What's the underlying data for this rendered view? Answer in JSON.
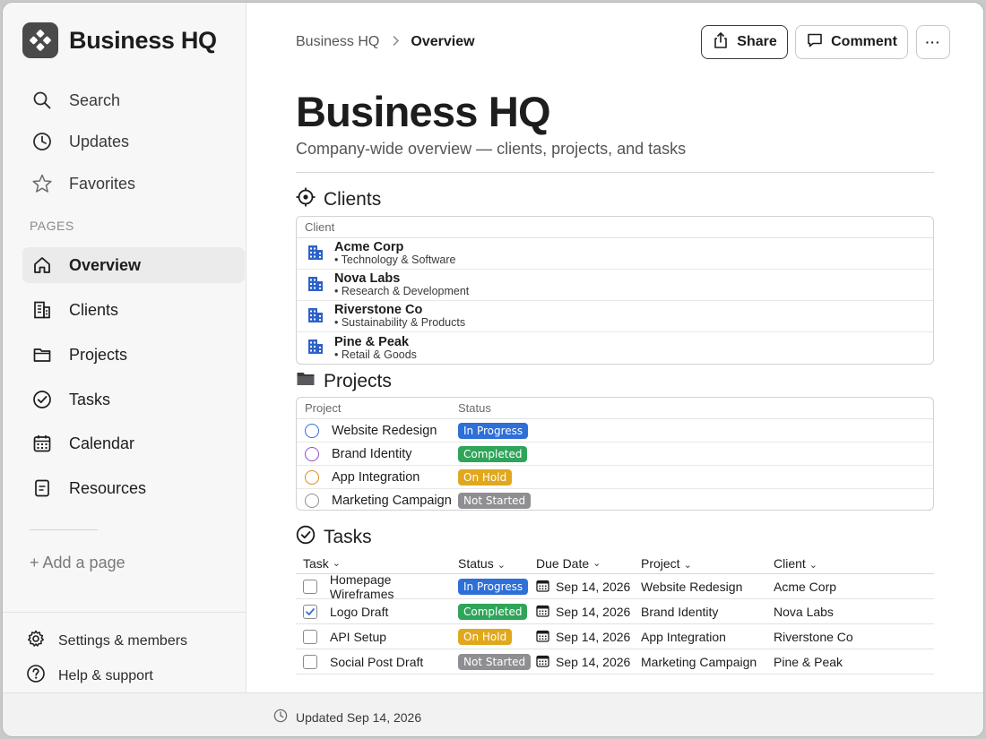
{
  "sidebar": {
    "brand": "Business HQ",
    "nav": [
      {
        "label": "Search",
        "icon": "search-icon"
      },
      {
        "label": "Updates",
        "icon": "clock-icon"
      },
      {
        "label": "Favorites",
        "icon": "star-icon"
      }
    ],
    "section_label": "PAGES",
    "pages": [
      {
        "label": "Overview",
        "icon": "home-icon",
        "active": true
      },
      {
        "label": "Clients",
        "icon": "building-icon"
      },
      {
        "label": "Projects",
        "icon": "folder-icon"
      },
      {
        "label": "Tasks",
        "icon": "check-circle-icon"
      },
      {
        "label": "Calendar",
        "icon": "calendar-icon"
      },
      {
        "label": "Resources",
        "icon": "document-icon"
      }
    ],
    "add_page": "+ Add a page",
    "footer": [
      {
        "label": "Settings & members",
        "icon": "gear-icon"
      },
      {
        "label": "Help & support",
        "icon": "help-icon"
      }
    ]
  },
  "header": {
    "breadcrumb_root": "Business HQ",
    "breadcrumb_current": "Overview",
    "share_label": "Share",
    "comment_label": "Comment",
    "more_label": "···"
  },
  "page": {
    "title": "Business HQ",
    "subtitle": "Company-wide overview — clients, projects, and tasks"
  },
  "clients": {
    "title": "Clients",
    "column": "Client",
    "rows": [
      {
        "name": "Acme Corp",
        "desc": "• Technology & Software"
      },
      {
        "name": "Nova Labs",
        "desc": "• Research & Development"
      },
      {
        "name": "Riverstone Co",
        "desc": "• Sustainability & Products"
      },
      {
        "name": "Pine & Peak",
        "desc": "• Retail & Goods"
      }
    ]
  },
  "projects": {
    "title": "Projects",
    "columns": [
      "Project",
      "Status"
    ],
    "rows": [
      {
        "name": "Website Redesign",
        "status": "In Progress",
        "color": "#2e6fd8"
      },
      {
        "name": "Brand Identity",
        "status": "Completed",
        "color": "#8e4fc7"
      },
      {
        "name": "App Integration",
        "status": "On Hold",
        "color": "#e08a1e"
      },
      {
        "name": "Marketing Campaign",
        "status": "Not Started",
        "color": "#8e8e93"
      }
    ]
  },
  "tasks": {
    "title": "Tasks",
    "columns": [
      "Task",
      "Status",
      "Due Date",
      "Project",
      "Client"
    ],
    "rows": [
      {
        "task": "Homepage Wireframes",
        "status": "In Progress",
        "due": "Sep 14, 2026",
        "project": "Website Redesign",
        "client": "Acme Corp",
        "checked": false
      },
      {
        "task": "Logo Draft",
        "status": "Completed",
        "due": "Sep 14, 2026",
        "project": "Brand Identity",
        "client": "Nova Labs",
        "checked": true
      },
      {
        "task": "API Setup",
        "status": "On Hold",
        "due": "Sep 14, 2026",
        "project": "App Integration",
        "client": "Riverstone Co",
        "checked": false
      },
      {
        "task": "Social Post Draft",
        "status": "Not Started",
        "due": "Sep 14, 2026",
        "project": "Marketing Campaign",
        "client": "Pine & Peak",
        "checked": false
      }
    ]
  },
  "status_bar": {
    "updated": "Updated Sep 14, 2026"
  },
  "colors": {
    "in_progress": "#2e6fd8",
    "completed": "#2fa55a",
    "on_hold": "#e0a81e",
    "not_started": "#8e8e93"
  }
}
